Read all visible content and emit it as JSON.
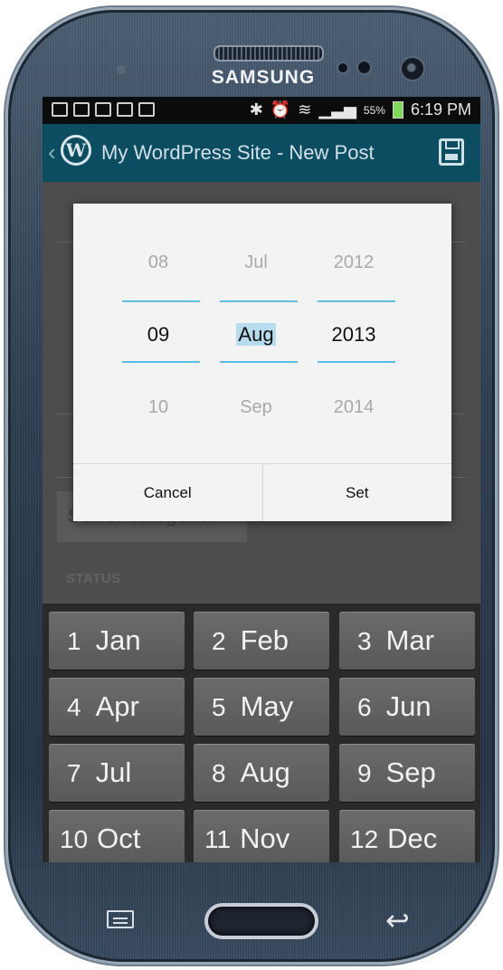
{
  "device": {
    "brand": "SAMSUNG"
  },
  "statusbar": {
    "battery": "55%",
    "time": "6:19 PM"
  },
  "appbar": {
    "title": "My WordPress Site - New Post",
    "logo_letter": "W"
  },
  "editor": {
    "category_button": "Select Categories",
    "status_label": "STATUS"
  },
  "date_picker": {
    "day": {
      "prev": "08",
      "selected": "09",
      "next": "10"
    },
    "month": {
      "prev": "Jul",
      "selected": "Aug",
      "next": "Sep"
    },
    "year": {
      "prev": "2012",
      "selected": "2013",
      "next": "2014"
    },
    "cancel_label": "Cancel",
    "set_label": "Set",
    "accent_color": "#5cbfe0"
  },
  "keyboard": {
    "keys": [
      {
        "num": "1",
        "label": "Jan"
      },
      {
        "num": "2",
        "label": "Feb"
      },
      {
        "num": "3",
        "label": "Mar"
      },
      {
        "num": "4",
        "label": "Apr"
      },
      {
        "num": "5",
        "label": "May"
      },
      {
        "num": "6",
        "label": "Jun"
      },
      {
        "num": "7",
        "label": "Jul"
      },
      {
        "num": "8",
        "label": "Aug"
      },
      {
        "num": "9",
        "label": "Sep"
      },
      {
        "num": "10",
        "label": "Oct"
      },
      {
        "num": "11",
        "label": "Nov"
      },
      {
        "num": "12",
        "label": "Dec"
      }
    ]
  },
  "colors": {
    "appbar": "#0d4d62",
    "key_bg": "#5f5f5f"
  }
}
